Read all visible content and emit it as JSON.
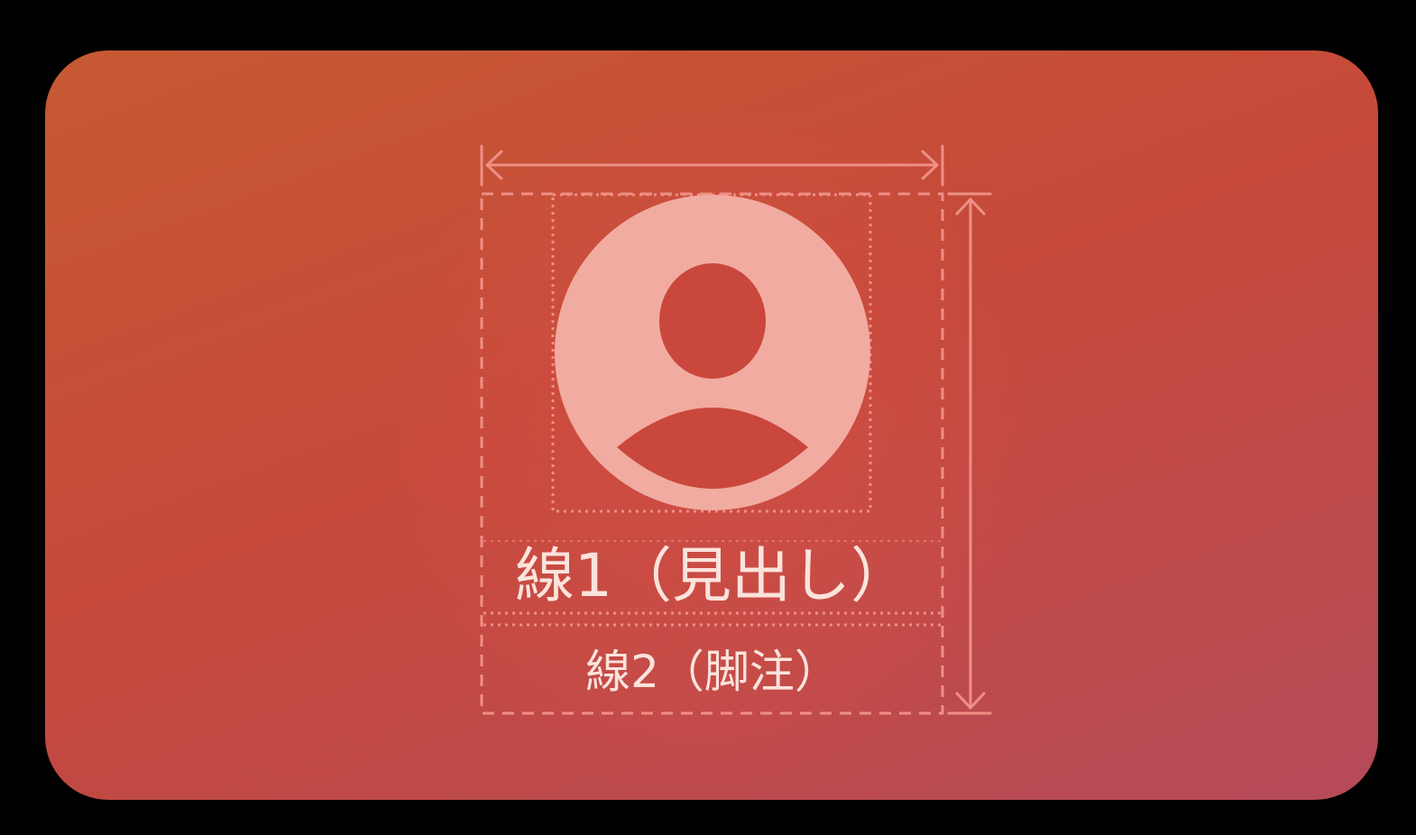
{
  "colors": {
    "background": "#000000",
    "gradient_start": "#c65a33",
    "gradient_mid": "#c6493a",
    "gradient_end": "#b64a59",
    "guide": "#ef8f86",
    "avatar_fill": "#f2aba0",
    "text": "#fbe3dc"
  },
  "labels": {
    "line1": "線1（見出し）",
    "line2": "線2（脚注）"
  },
  "icons": {
    "avatar": "person-circle-icon",
    "width_arrow": "horizontal-double-arrow",
    "height_arrow": "vertical-double-arrow"
  }
}
